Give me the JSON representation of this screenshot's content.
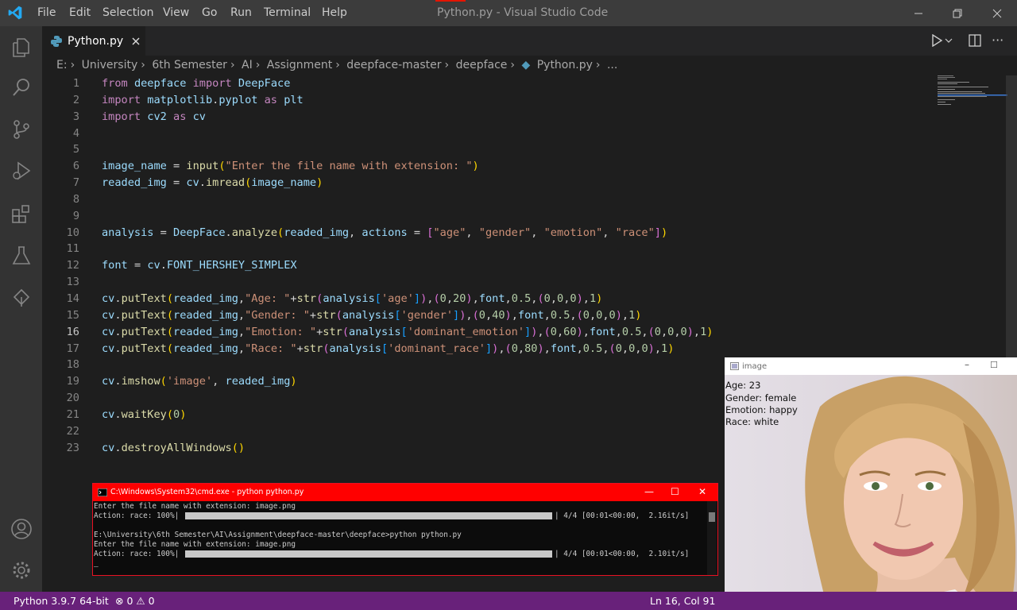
{
  "app": {
    "window_title": "Python.py - Visual Studio Code",
    "menu": [
      "File",
      "Edit",
      "Selection",
      "View",
      "Go",
      "Run",
      "Terminal",
      "Help"
    ]
  },
  "activity_icons": [
    "explorer-icon",
    "search-icon",
    "source-control-icon",
    "run-debug-icon",
    "extensions-icon",
    "testing-icon",
    "tree-icon"
  ],
  "activity_bottom_icons": [
    "account-icon",
    "settings-gear-icon"
  ],
  "tab": {
    "label": "Python.py"
  },
  "breadcrumb": [
    "E:",
    "University",
    "6th Semester",
    "AI",
    "Assignment",
    "deepface-master",
    "deepface",
    "Python.py",
    "..."
  ],
  "editor": {
    "active_line": 16,
    "lines": [
      {
        "n": 1,
        "text": "from deepface import DeepFace"
      },
      {
        "n": 2,
        "text": "import matplotlib.pyplot as plt"
      },
      {
        "n": 3,
        "text": "import cv2 as cv"
      },
      {
        "n": 4,
        "text": ""
      },
      {
        "n": 5,
        "text": ""
      },
      {
        "n": 6,
        "text": "image_name = input(\"Enter the file name with extension: \")"
      },
      {
        "n": 7,
        "text": "readed_img = cv.imread(image_name)"
      },
      {
        "n": 8,
        "text": ""
      },
      {
        "n": 9,
        "text": ""
      },
      {
        "n": 10,
        "text": "analysis = DeepFace.analyze(readed_img, actions = [\"age\", \"gender\", \"emotion\", \"race\"])"
      },
      {
        "n": 11,
        "text": ""
      },
      {
        "n": 12,
        "text": "font = cv.FONT_HERSHEY_SIMPLEX"
      },
      {
        "n": 13,
        "text": ""
      },
      {
        "n": 14,
        "text": "cv.putText(readed_img,\"Age: \"+str(analysis['age']),(0,20),font,0.5,(0,0,0),1)"
      },
      {
        "n": 15,
        "text": "cv.putText(readed_img,\"Gender: \"+str(analysis['gender']),(0,40),font,0.5,(0,0,0),1)"
      },
      {
        "n": 16,
        "text": "cv.putText(readed_img,\"Emotion: \"+str(analysis['dominant_emotion']),(0,60),font,0.5,(0,0,0),1)"
      },
      {
        "n": 17,
        "text": "cv.putText(readed_img,\"Race: \"+str(analysis['dominant_race']),(0,80),font,0.5,(0,0,0),1)"
      },
      {
        "n": 18,
        "text": ""
      },
      {
        "n": 19,
        "text": "cv.imshow('image', readed_img)"
      },
      {
        "n": 20,
        "text": ""
      },
      {
        "n": 21,
        "text": "cv.waitKey(0)"
      },
      {
        "n": 22,
        "text": ""
      },
      {
        "n": 23,
        "text": "cv.destroyAllWindows()"
      }
    ]
  },
  "cmd_window": {
    "title": "C:\\Windows\\System32\\cmd.exe - python  python.py",
    "lines": [
      "Enter the file name with extension: image.png",
      "Action: race: 100%|",
      "",
      "E:\\University\\6th Semester\\AI\\Assignment\\deepface-master\\deepface>python python.py",
      "Enter the file name with extension: image.png",
      "Action: race: 100%|"
    ],
    "progress": [
      {
        "fraction": 1.0,
        "stats": "| 4/4 [00:01<00:00,  2.16it/s]"
      },
      {
        "fraction": 1.0,
        "stats": "| 4/4 [00:01<00:00,  2.10it/s]"
      }
    ],
    "cursor": "_"
  },
  "image_window": {
    "title": "image",
    "overlay": [
      "Age: 23",
      "Gender: female",
      "Emotion: happy",
      "Race: white"
    ]
  },
  "status": {
    "python": "Python 3.9.7 64-bit",
    "errors": "0",
    "warnings": "0",
    "position": "Ln 16, Col 91"
  },
  "colors": {
    "status_bar": "#68217a",
    "cmd_title": "#ff0000",
    "editor_bg": "#1e1e1e"
  }
}
